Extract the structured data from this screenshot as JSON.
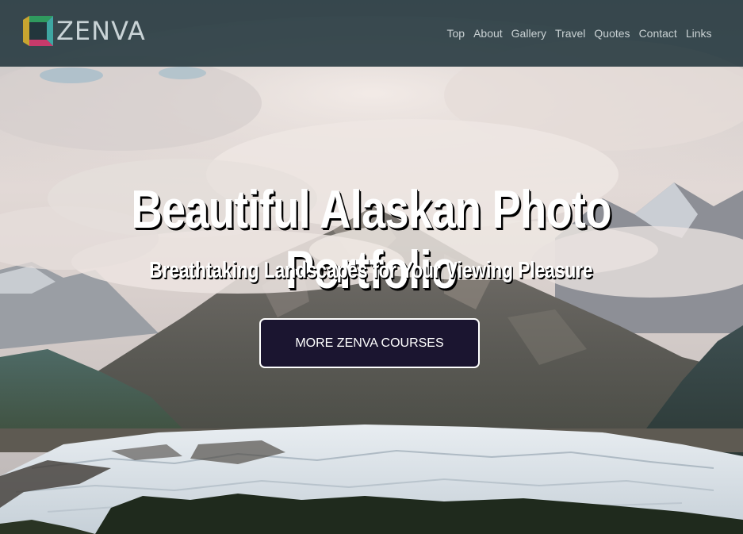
{
  "header": {
    "logo_text": "ZENVA",
    "logo_icon": "zenva-square-logo",
    "nav": [
      {
        "label": "Top"
      },
      {
        "label": "About"
      },
      {
        "label": "Gallery"
      },
      {
        "label": "Travel"
      },
      {
        "label": "Quotes"
      },
      {
        "label": "Contact"
      },
      {
        "label": "Links"
      }
    ]
  },
  "hero": {
    "title": "Beautiful Alaskan Photo Portfolio",
    "subtitle": "Breathtaking Landscapes for Your Viewing Pleasure",
    "cta_label": "MORE ZENVA COURSES",
    "background": "alaskan-glacier-mountain-photo"
  },
  "colors": {
    "navbar_bg": "#22363c",
    "nav_text": "#c9d1d3",
    "cta_bg": "#1b1530",
    "cta_border": "#ffffff",
    "title_text": "#ffffff"
  }
}
